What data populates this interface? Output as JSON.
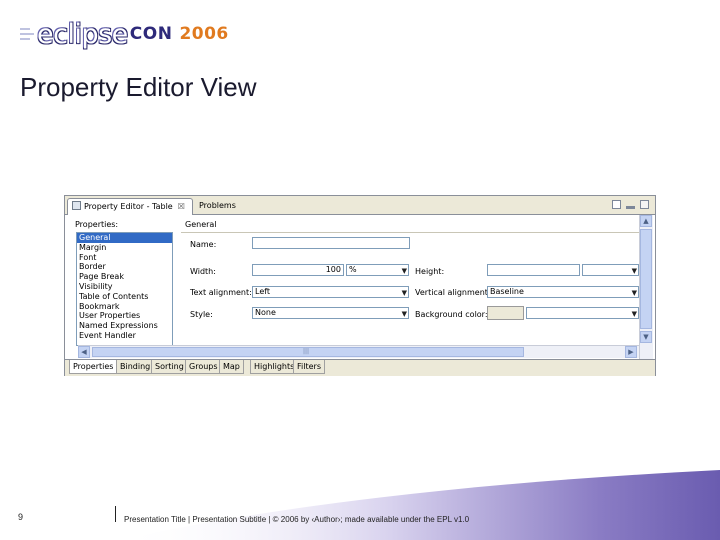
{
  "logo": {
    "word": "eclipse",
    "con": "CON",
    "year": "2006"
  },
  "slide_title": "Property Editor View",
  "view": {
    "tabs": [
      {
        "label": "Property Editor - Table",
        "close": "☒"
      },
      {
        "label": "Problems"
      }
    ],
    "properties_header": "Properties:",
    "list_items": [
      "General",
      "Margin",
      "Font",
      "Border",
      "Page Break",
      "Visibility",
      "Table of Contents",
      "Bookmark",
      "User Properties",
      "Named Expressions",
      "Event Handler"
    ],
    "selected_item": "General",
    "section_header": "General",
    "fields": {
      "name_label": "Name:",
      "name_value": "",
      "width_label": "Width:",
      "width_value": "100",
      "width_unit": "%",
      "height_label": "Height:",
      "height_value": "",
      "height_unit": "",
      "text_alignment_label": "Text alignment:",
      "text_alignment_value": "Left",
      "vertical_alignment_label": "Vertical alignment:",
      "vertical_alignment_value": "Baseline",
      "style_label": "Style:",
      "style_value": "None",
      "background_color_label": "Background color:",
      "background_color_value": ""
    },
    "bottom_tabs": [
      "Properties",
      "Binding",
      "Sorting",
      "Groups",
      "Map",
      "Highlights",
      "Filters"
    ],
    "active_bottom_tab": "Properties",
    "hscroll_grip": "|||"
  },
  "footer": {
    "page_number": "9",
    "text": "Presentation Title | Presentation Subtitle | © 2006 by ‹Author›; made available under the EPL v1.0"
  },
  "colors": {
    "accent_purple": "#6e63b0",
    "selection_blue": "#316ac5",
    "logo_orange": "#e07a1f"
  }
}
